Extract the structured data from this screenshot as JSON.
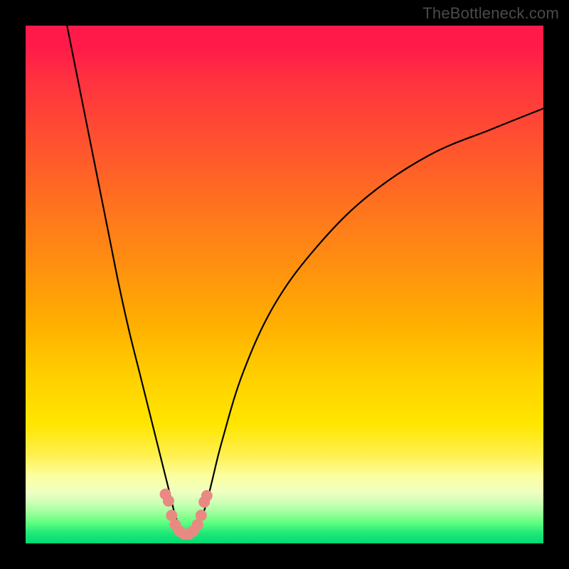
{
  "watermark": "TheBottleneck.com",
  "chart_data": {
    "type": "line",
    "title": "",
    "xlabel": "",
    "ylabel": "",
    "xlim": [
      0,
      100
    ],
    "ylim": [
      0,
      100
    ],
    "gradient_stops": [
      {
        "pos": 0,
        "color": "#ff1a4a"
      },
      {
        "pos": 50,
        "color": "#ffb000"
      },
      {
        "pos": 80,
        "color": "#fff050"
      },
      {
        "pos": 100,
        "color": "#00db74"
      }
    ],
    "series": [
      {
        "name": "bottleneck-curve",
        "x": [
          8,
          10,
          12,
          14,
          16,
          18,
          20,
          22,
          24,
          26,
          27,
          28,
          29,
          30,
          31,
          32,
          33,
          34,
          35,
          36,
          38,
          42,
          48,
          56,
          66,
          78,
          90,
          100
        ],
        "y": [
          100,
          90,
          80,
          70,
          60,
          50,
          41,
          33,
          25,
          17,
          13,
          9,
          5,
          3,
          2,
          2,
          3,
          5,
          8,
          12,
          20,
          33,
          46,
          57,
          67,
          75,
          80,
          84
        ]
      }
    ],
    "marker_cluster": {
      "name": "minimum-markers",
      "color": "#e98a82",
      "points": [
        {
          "x": 27.0,
          "y": 9.5,
          "r": 1.1
        },
        {
          "x": 27.6,
          "y": 8.2,
          "r": 1.1
        },
        {
          "x": 28.2,
          "y": 5.4,
          "r": 1.1
        },
        {
          "x": 28.9,
          "y": 3.6,
          "r": 1.1
        },
        {
          "x": 29.7,
          "y": 2.4,
          "r": 1.1
        },
        {
          "x": 30.6,
          "y": 1.8,
          "r": 1.1
        },
        {
          "x": 31.5,
          "y": 1.8,
          "r": 1.1
        },
        {
          "x": 32.4,
          "y": 2.4,
          "r": 1.1
        },
        {
          "x": 33.2,
          "y": 3.6,
          "r": 1.1
        },
        {
          "x": 33.9,
          "y": 5.4,
          "r": 1.1
        },
        {
          "x": 34.5,
          "y": 8.0,
          "r": 1.1
        },
        {
          "x": 35.0,
          "y": 9.2,
          "r": 1.1
        }
      ]
    }
  }
}
